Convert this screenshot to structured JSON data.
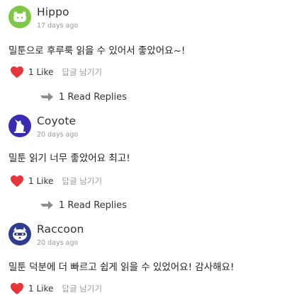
{
  "comments": [
    {
      "username": "Hippo",
      "time": "17 days ago",
      "text": "밀툰으로 후루룩 읽을 수 있어서 좋았어요~!",
      "like_label": "1 Like",
      "reply_label": "답글 남기기",
      "read_replies_label": "1 Read Replies",
      "avatar_icon": "hippo-icon",
      "avatar_color": "#7ec845"
    },
    {
      "username": "Coyote",
      "time": "20 days ago",
      "text": "밀툰 읽기 너무 좋았어요 최고!",
      "like_label": "1 Like",
      "reply_label": "답글 남기기",
      "read_replies_label": "1 Read Replies",
      "avatar_icon": "coyote-icon",
      "avatar_color": "#3a2bb0"
    },
    {
      "username": "Raccoon",
      "time": "20 days ago",
      "text": "밀툰 덕분에 더 빠르고 쉽게 읽을 수 있었어요! 감사해요!",
      "like_label": "1 Like",
      "reply_label": "답글 남기기",
      "avatar_icon": "raccoon-icon",
      "avatar_color": "#2f3b8f"
    }
  ],
  "colors": {
    "heart": "#e5373a",
    "arrow": "#8c8c8c",
    "muted_text": "#9a9a9a"
  }
}
